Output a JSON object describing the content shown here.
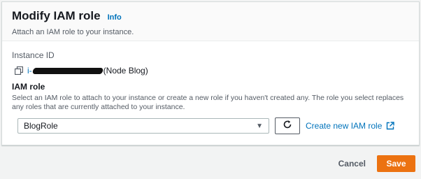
{
  "header": {
    "title": "Modify IAM role",
    "info_label": "Info",
    "subtitle": "Attach an IAM role to your instance."
  },
  "instance": {
    "label": "Instance ID",
    "id_prefix": "i-",
    "id_suffix": "(Node Blog)"
  },
  "iam_role": {
    "label": "IAM role",
    "description": "Select an IAM role to attach to your instance or create a new role if you haven't created any. The role you select replaces any roles that are currently attached to your instance.",
    "selected_value": "BlogRole",
    "create_link_label": "Create new IAM role"
  },
  "footer": {
    "cancel_label": "Cancel",
    "save_label": "Save"
  },
  "colors": {
    "accent": "#ec7211",
    "link": "#0073bb"
  },
  "icons": [
    "copy-icon",
    "caret-down-icon",
    "refresh-icon",
    "external-link-icon"
  ]
}
